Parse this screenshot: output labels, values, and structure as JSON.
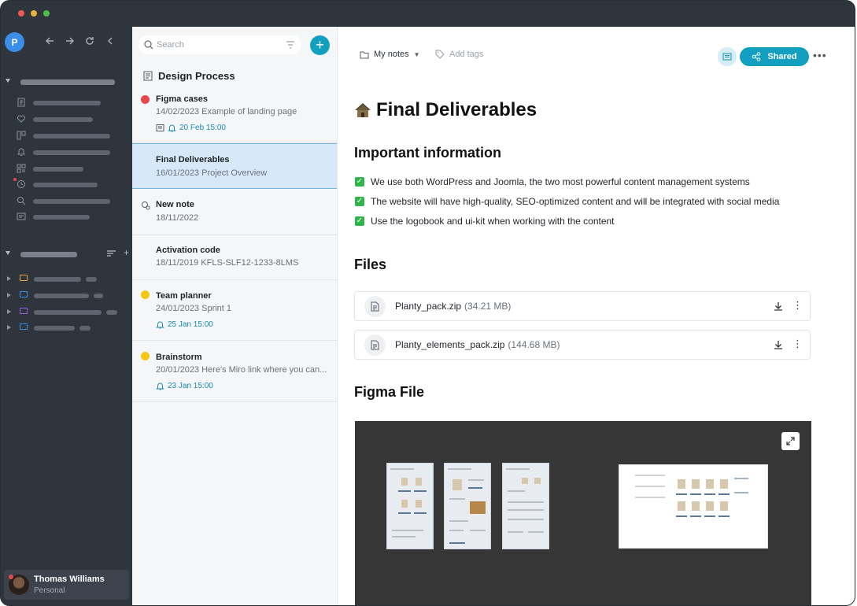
{
  "sidebar": {
    "avatar_letter": "P",
    "user": {
      "name": "Thomas Williams",
      "plan": "Personal"
    }
  },
  "notelist": {
    "search_placeholder": "Search",
    "notebook_title": "Design Process",
    "notes": [
      {
        "title": "Figma cases",
        "sub": "14/02/2023 Example of landing page",
        "reminder": "20 Feb 15:00",
        "dot_color": "#e5484d",
        "active": false
      },
      {
        "title": "Final Deliverables",
        "sub": "16/01/2023 Project Overview",
        "reminder": "",
        "dot_color": "",
        "active": true
      },
      {
        "title": "New note",
        "sub": "18/11/2022",
        "reminder": "",
        "dot_color": "",
        "active": false
      },
      {
        "title": "Activation code",
        "sub": "18/11/2019 KFLS-SLF12-1233-8LMS",
        "reminder": "",
        "dot_color": "",
        "active": false
      },
      {
        "title": "Team planner",
        "sub": "24/01/2023 Sprint 1",
        "reminder": "25 Jan 15:00",
        "dot_color": "#f5c518",
        "active": false
      },
      {
        "title": "Brainstorm",
        "sub": "20/01/2023 Here's Miro link where you can...",
        "reminder": "23 Jan 15:00",
        "dot_color": "#f5c518",
        "active": false
      }
    ]
  },
  "toolbar": {
    "notebook": "My notes",
    "add_tags": "Add tags",
    "shared_label": "Shared"
  },
  "document": {
    "title": "Final Deliverables",
    "section_info": "Important information",
    "checklist": [
      "We use both WordPress and Joomla, the two most powerful content management systems",
      "The website will have high-quality, SEO-optimized content and will be integrated with social media",
      "Use the logobook and ui-kit when working with the content"
    ],
    "section_files": "Files",
    "files": [
      {
        "name": "Planty_pack.zip",
        "size": "(34.21 MB)"
      },
      {
        "name": "Planty_elements_pack.zip",
        "size": "(144.68 MB)"
      }
    ],
    "section_figma": "Figma File"
  },
  "colors": {
    "accent": "#129fc0",
    "sidebar_bg": "#2f353d",
    "active_note_bg": "#d7e9f8",
    "check_green": "#2fb54a"
  }
}
